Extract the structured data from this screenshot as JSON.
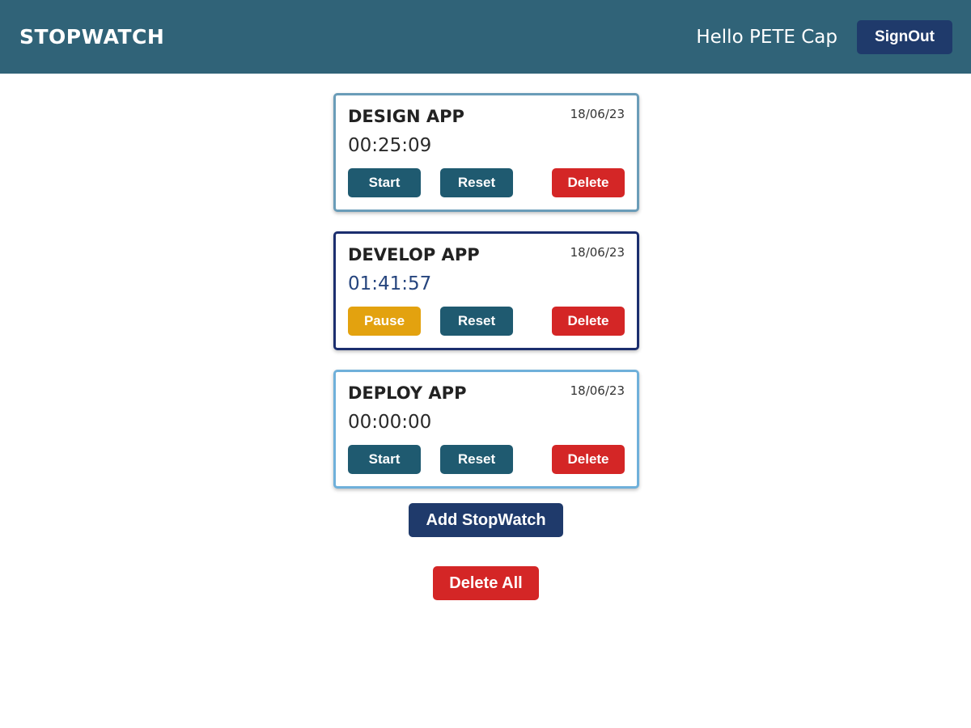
{
  "header": {
    "brand": "STOPWATCH",
    "greeting": "Hello PETE Cap",
    "signout_label": "SignOut",
    "background": "#306378"
  },
  "stopwatches": [
    {
      "title": "DESIGN APP",
      "date": "18/06/23",
      "time": "00:25:09",
      "state": "stopped",
      "primary_label": "Start",
      "reset_label": "Reset",
      "delete_label": "Delete"
    },
    {
      "title": "DEVELOP APP",
      "date": "18/06/23",
      "time": "01:41:57",
      "state": "running",
      "primary_label": "Pause",
      "reset_label": "Reset",
      "delete_label": "Delete"
    },
    {
      "title": "DEPLOY APP",
      "date": "18/06/23",
      "time": "00:00:00",
      "state": "idle",
      "primary_label": "Start",
      "reset_label": "Reset",
      "delete_label": "Delete"
    }
  ],
  "actions": {
    "add_label": "Add StopWatch",
    "delete_all_label": "Delete All"
  },
  "colors": {
    "primary": "#1f5a70",
    "pause": "#e3a20f",
    "danger": "#d42626",
    "navy": "#1f3a6b"
  }
}
